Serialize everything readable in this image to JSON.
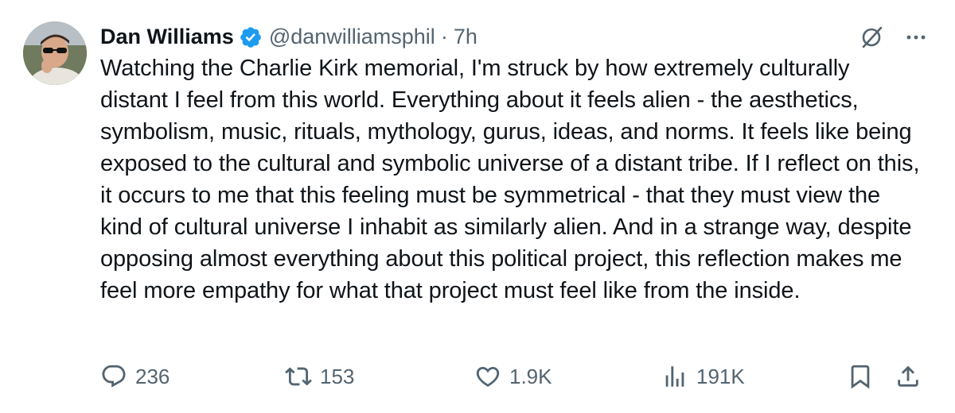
{
  "author": {
    "name": "Dan Williams",
    "handle": "@danwilliamsphil",
    "separator": "·",
    "time": "7h",
    "verified": true
  },
  "tweet": {
    "text": "Watching the Charlie Kirk memorial, I'm struck by how extremely culturally distant I feel from this world. Everything about it feels alien - the aesthetics, symbolism, music, rituals, mythology, gurus, ideas, and norms. It feels like being exposed to the cultural and symbolic universe of a distant tribe. If I reflect on this, it occurs to me that this feeling must be symmetrical - that they must view the kind of cultural universe I inhabit as similarly alien. And in a strange way, despite opposing almost everything about this political project, this reflection makes me feel more empathy for what that project must feel like from the inside."
  },
  "stats": {
    "replies": "236",
    "reposts": "153",
    "likes": "1.9K",
    "views": "191K"
  },
  "icons": {
    "verified": "verified-badge-icon",
    "grok": "grok-icon",
    "more": "more-icon",
    "reply": "reply-icon",
    "repost": "repost-icon",
    "like": "heart-icon",
    "views": "views-icon",
    "bookmark": "bookmark-icon",
    "share": "share-icon"
  },
  "colors": {
    "text": "#0f1419",
    "secondary": "#536471",
    "verified": "#1d9bf0"
  }
}
